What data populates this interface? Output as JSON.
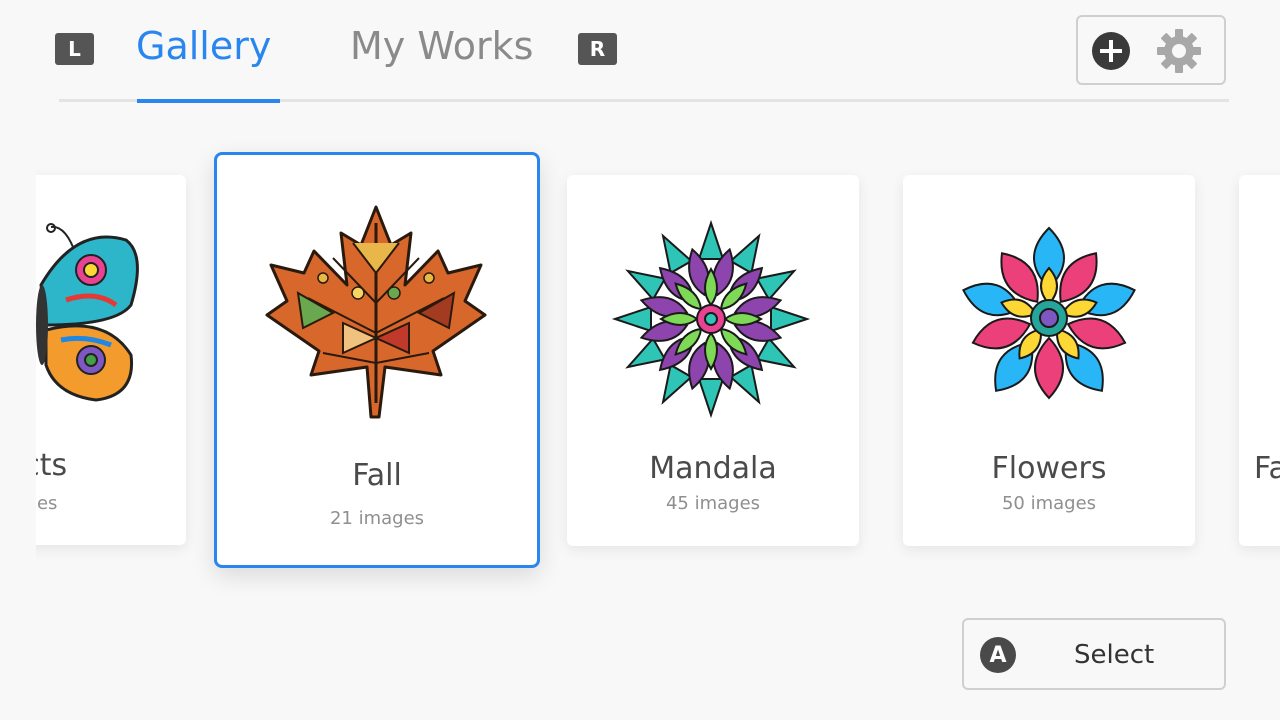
{
  "header": {
    "left_bumper": "L",
    "right_bumper": "R",
    "tabs": [
      {
        "label": "Gallery",
        "active": true
      },
      {
        "label": "My Works",
        "active": false
      }
    ],
    "accent_color": "#2a86ef",
    "tool_icons": [
      "plus-circle-icon",
      "gear-icon"
    ]
  },
  "categories": [
    {
      "title": "ects",
      "subtitle": "ages",
      "art_icon": "butterfly-icon"
    },
    {
      "title": "Fall",
      "subtitle": "21 images",
      "art_icon": "maple-leaf-icon",
      "selected": true
    },
    {
      "title": "Mandala",
      "subtitle": "45 images",
      "art_icon": "mandala-icon"
    },
    {
      "title": "Flowers",
      "subtitle": "50 images",
      "art_icon": "flower-icon"
    },
    {
      "title": "Fa",
      "subtitle": "",
      "art_icon": ""
    }
  ],
  "footer": {
    "action_button_glyph": "A",
    "action_label": "Select"
  }
}
